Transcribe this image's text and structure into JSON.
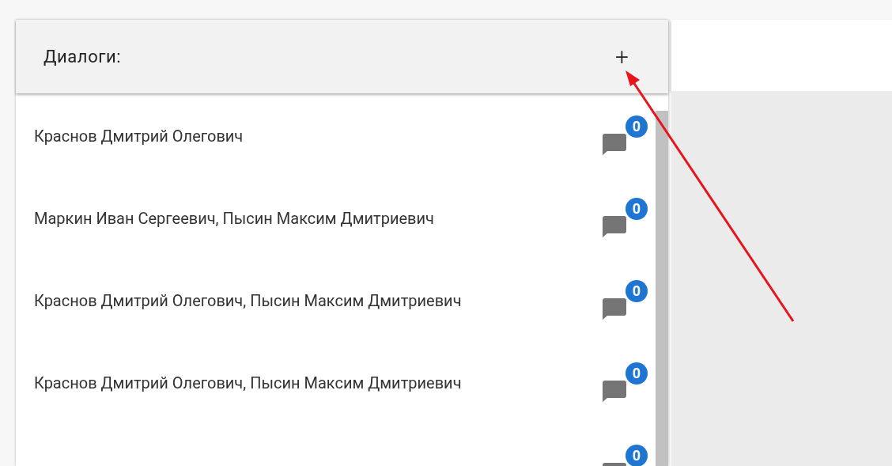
{
  "dialogs": {
    "title": "Диалоги:",
    "add_label": "+",
    "items": [
      {
        "name": "Краснов Дмитрий Олегович",
        "unread": "0"
      },
      {
        "name": "Маркин Иван Сергеевич, Пысин Максим Дмитриевич",
        "unread": "0"
      },
      {
        "name": "Краснов Дмитрий Олегович, Пысин Максим Дмитриевич",
        "unread": "0"
      },
      {
        "name": "Краснов Дмитрий Олегович, Пысин Максим Дмитриевич",
        "unread": "0"
      },
      {
        "unread": "0"
      }
    ]
  }
}
